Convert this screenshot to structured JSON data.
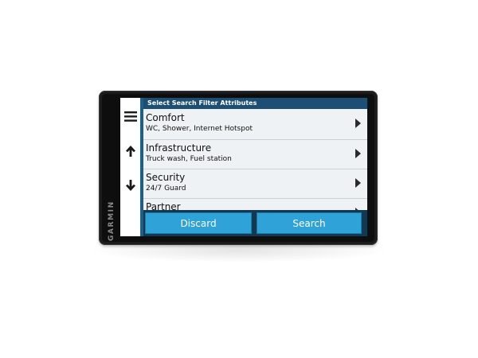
{
  "device": {
    "brand": "GARMIN"
  },
  "screen": {
    "header_title": "Select Search Filter Attributes",
    "side_buttons": [
      {
        "icon": "menu-icon"
      },
      {
        "icon": "arrow-up-icon"
      },
      {
        "icon": "arrow-down-icon"
      }
    ],
    "rows": [
      {
        "title": "Comfort",
        "subtitle": "WC, Shower, Internet Hotspot"
      },
      {
        "title": "Infrastructure",
        "subtitle": "Truck wash, Fuel station"
      },
      {
        "title": "Security",
        "subtitle": "24/7 Guard"
      },
      {
        "title": "Partner",
        "subtitle": ""
      }
    ],
    "buttons": {
      "discard_label": "Discard",
      "search_label": "Search"
    }
  },
  "colors": {
    "header_bg": "#1d4f74",
    "button_bg": "#2fa3d8",
    "footer_bg": "#14384f",
    "list_bg": "#eef2f4"
  }
}
